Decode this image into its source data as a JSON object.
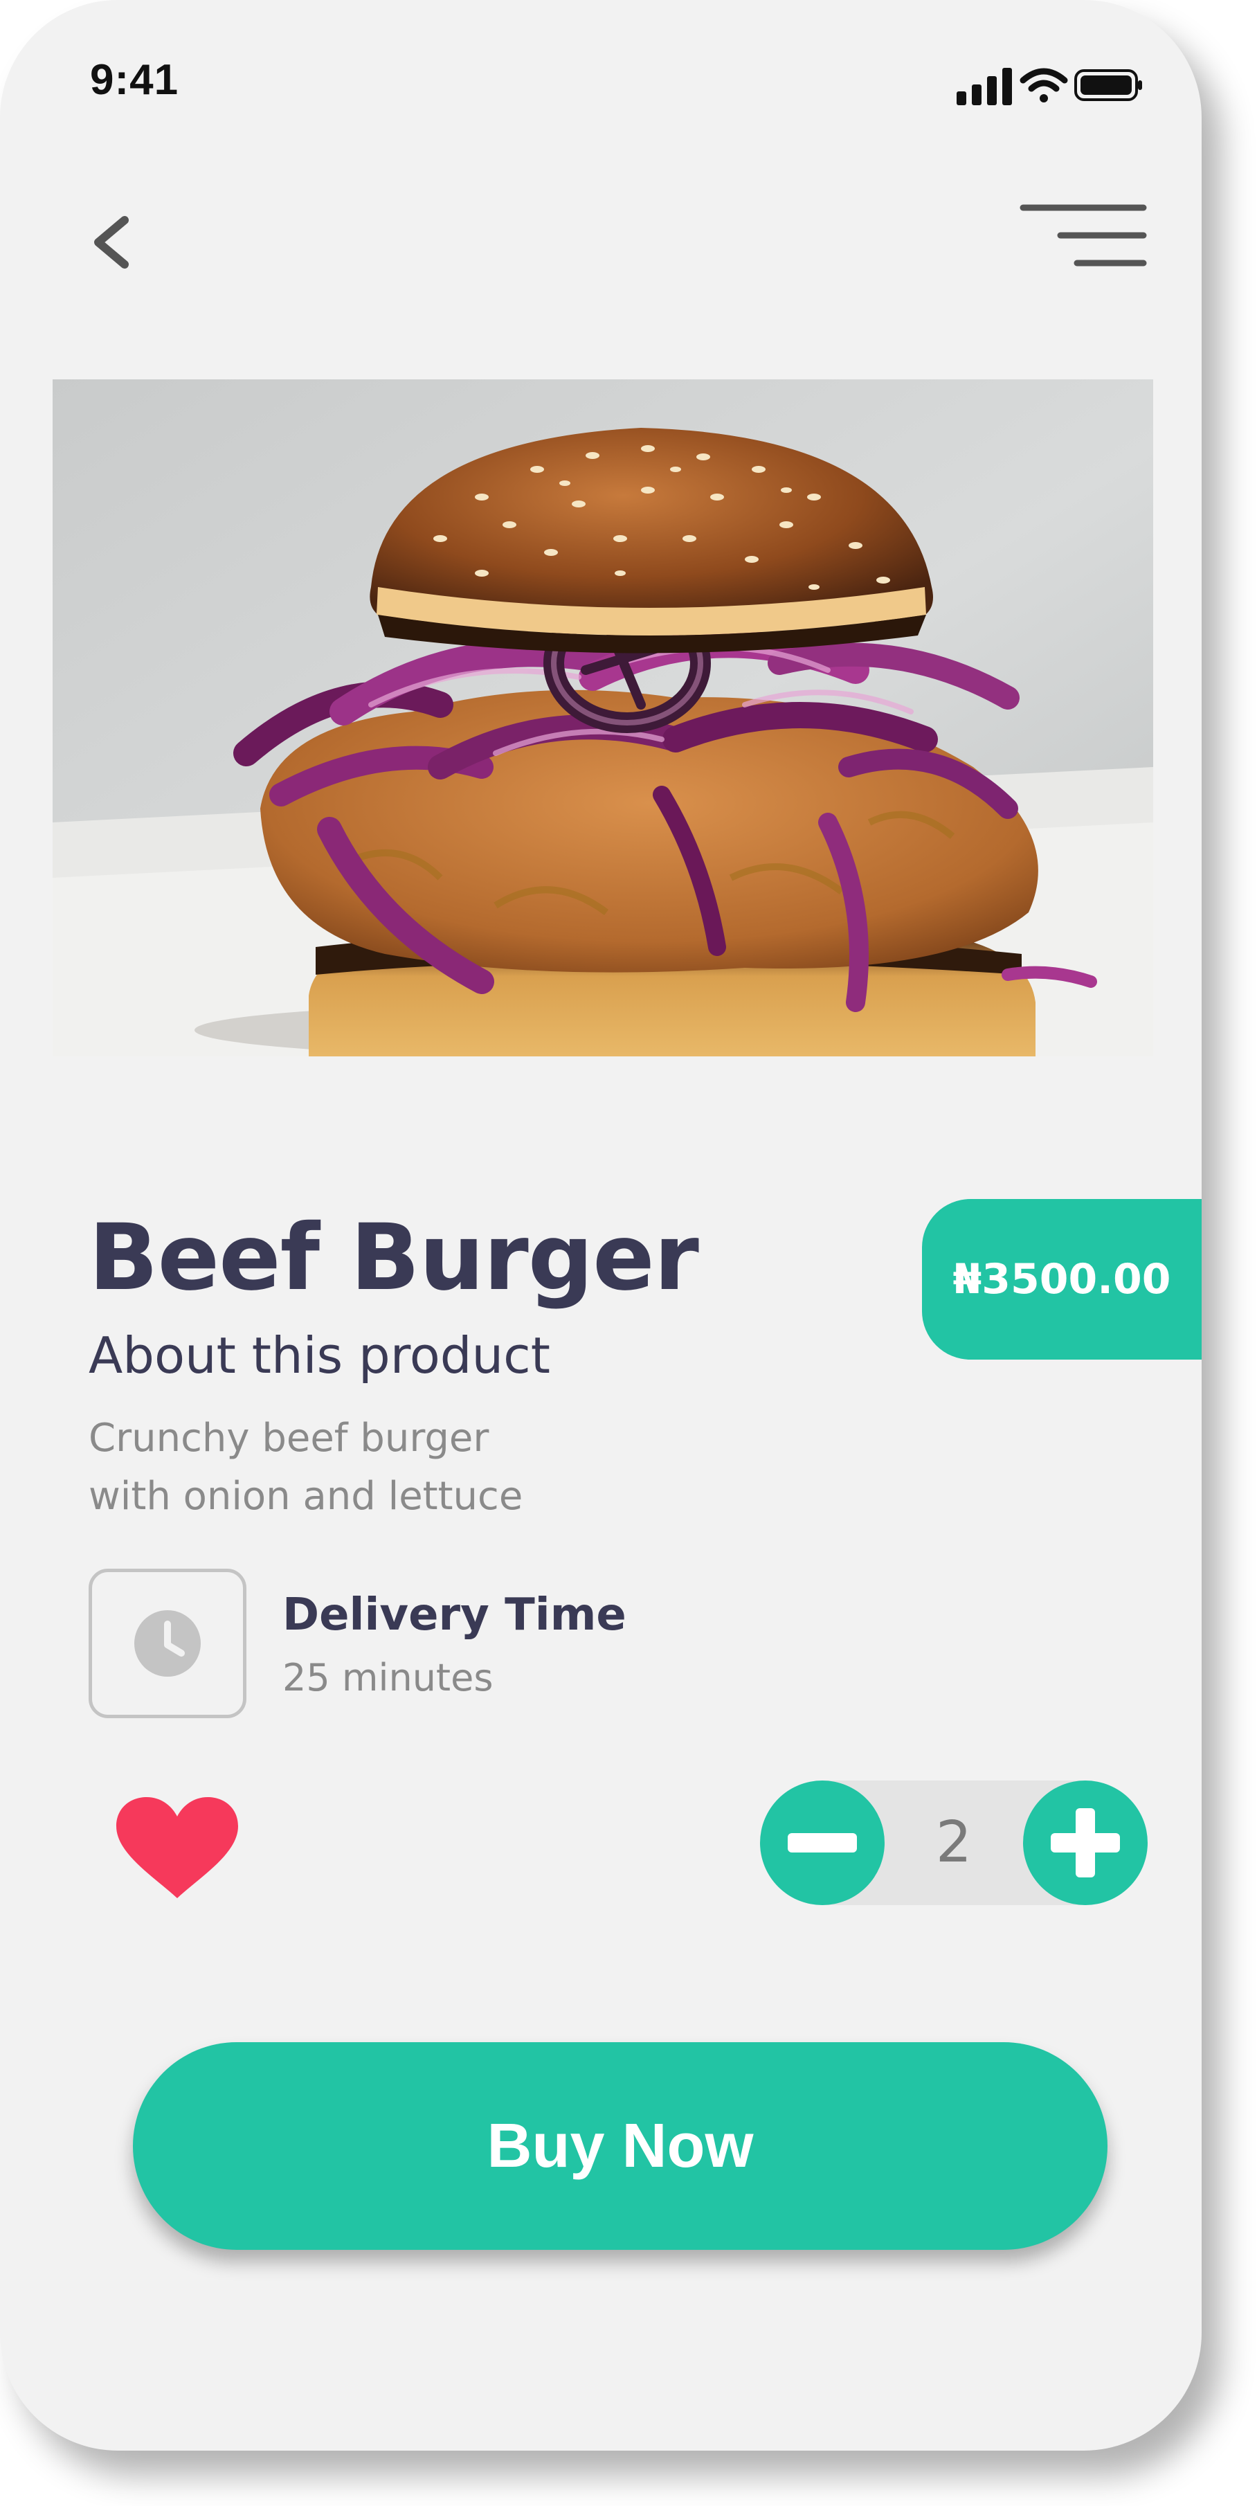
{
  "status_bar": {
    "time": "9:41",
    "icons": [
      "signal-icon",
      "wifi-icon",
      "battery-icon"
    ]
  },
  "nav": {
    "back_icon": "chevron-left-icon",
    "menu_icon": "menu-icon"
  },
  "product": {
    "name": "Beef Burger",
    "price": "₦3500.00",
    "about_heading": "About this product",
    "description_lines": [
      "Crunchy beef burger",
      "with onion and lettuce"
    ],
    "image": "burger-photo"
  },
  "delivery": {
    "icon": "clock-icon",
    "label": "Delivery Time",
    "value": "25 minutes"
  },
  "favorite": {
    "icon": "heart-icon",
    "active": true
  },
  "quantity": {
    "value": "2",
    "decrement_icon": "minus-icon",
    "increment_icon": "plus-icon"
  },
  "cta": {
    "label": "Buy Now"
  },
  "colors": {
    "accent": "#22c4a4",
    "heading": "#3a3a55",
    "muted": "#8a8a8a",
    "heart": "#f6395b",
    "background": "#f2f2f2"
  }
}
